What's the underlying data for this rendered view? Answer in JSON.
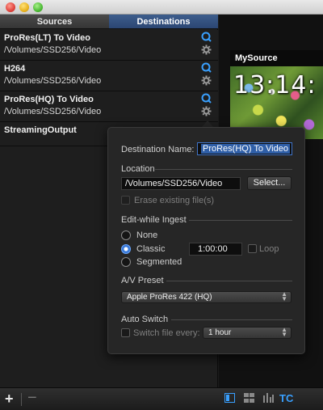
{
  "tabs": {
    "sources": "Sources",
    "destinations": "Destinations"
  },
  "destinations": [
    {
      "name": "ProRes(LT) To Video",
      "path": "/Volumes/SSD256/Video"
    },
    {
      "name": "H264",
      "path": "/Volumes/SSD256/Video"
    },
    {
      "name": "ProRes(HQ) To Video",
      "path": "/Volumes/SSD256/Video"
    },
    {
      "name": "StreamingOutput",
      "path": ""
    }
  ],
  "preview": {
    "source_name": "MySource",
    "timecode": "13:14:"
  },
  "popover": {
    "destination_name_label": "Destination Name:",
    "destination_name_value": "ProRes(HQ) To Video",
    "location_label": "Location",
    "location_value": "/Volumes/SSD256/Video",
    "select_button": "Select...",
    "erase_label": "Erase existing file(s)",
    "edit_while_ingest_label": "Edit-while Ingest",
    "radio_none": "None",
    "radio_classic": "Classic",
    "radio_segmented": "Segmented",
    "duration_value": "1:00:00",
    "loop_label": "Loop",
    "av_preset_label": "A/V Preset",
    "av_preset_value": "Apple ProRes 422 (HQ)",
    "auto_switch_label": "Auto Switch",
    "switch_every_label": "Switch file every:",
    "switch_every_value": "1 hour",
    "selected_mode": "Classic"
  },
  "bottombar": {
    "add": "+",
    "remove": "−",
    "tc": "TC"
  },
  "colors": {
    "accent": "#39a0ff",
    "tab_active": "#2b4673"
  }
}
